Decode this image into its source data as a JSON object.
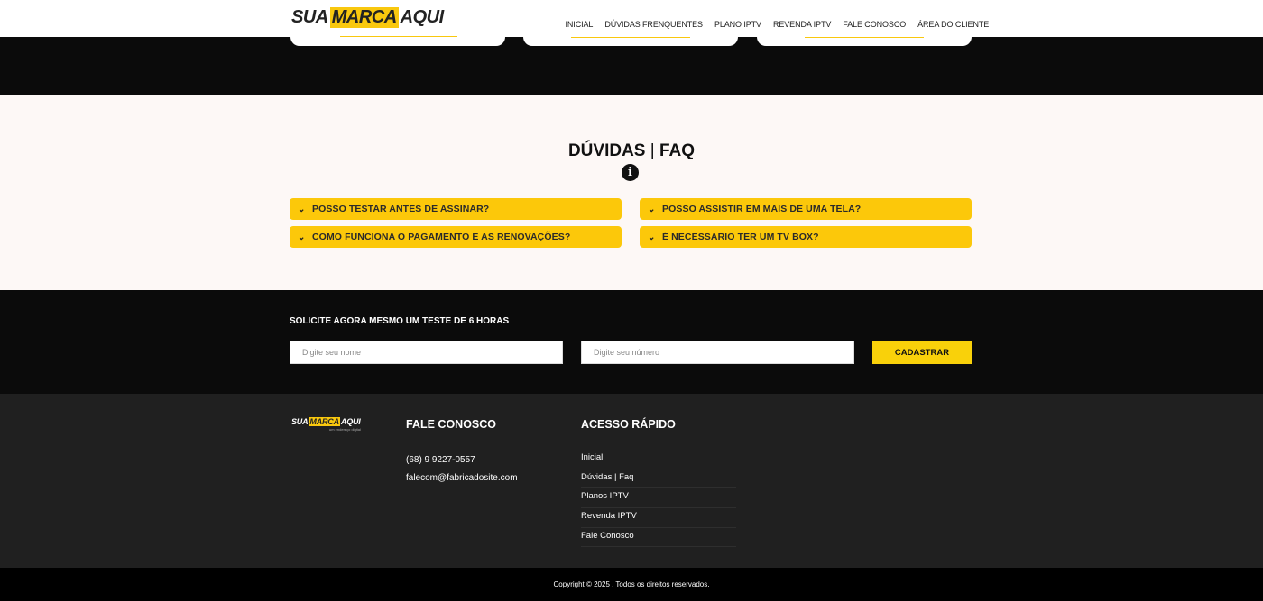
{
  "header": {
    "logo": {
      "part1": "SUA",
      "part2": "MARCA",
      "part3": "AQUI"
    },
    "nav": [
      "INICIAL",
      "DÚVIDAS FRENQUENTES",
      "PLANO IPTV",
      "REVENDA IPTV",
      "FALE CONOSCO",
      "ÁREA DO CLIENTE"
    ]
  },
  "faq": {
    "title_main": "DÚVIDAS",
    "title_sep": "|",
    "title_end": "FAQ",
    "info_icon": "info-circle-icon",
    "chevron_icon": "chevron-down-icon",
    "items": [
      "POSSO TESTAR ANTES DE ASSINAR?",
      "POSSO ASSISTIR EM MAIS DE UMA TELA?",
      "COMO FUNCIONA O PAGAMENTO E AS RENOVAÇÕES?",
      "É NECESSARIO TER UM TV BOX?"
    ]
  },
  "signup": {
    "title": "SOLICITE AGORA MESMO UM TESTE DE 6 HORAS",
    "name_placeholder": "Digite seu nome",
    "number_placeholder": "Digite seu número",
    "button": "CADASTRAR"
  },
  "footer": {
    "logo": {
      "part1": "SUA",
      "part2": "MARCA",
      "part3": "AQUI",
      "tagline": "um endereço digital"
    },
    "contact_heading": "FALE CONOSCO",
    "phone": "(68) 9 9227-0557",
    "email": "falecom@fabricadosite.com",
    "quick_heading": "ACESSO RÁPIDO",
    "quick_links": [
      "Inicial",
      "Dúvidas | Faq",
      "Planos IPTV",
      "Revenda IPTV",
      "Fale Conosco"
    ]
  },
  "copyright": "Copyright © 2025 . Todos os direitos reservados.",
  "colors": {
    "accent": "#fcc80a",
    "dark": "#0b0b0b",
    "footer": "#202020",
    "faq_bg": "#fdf8f6"
  }
}
